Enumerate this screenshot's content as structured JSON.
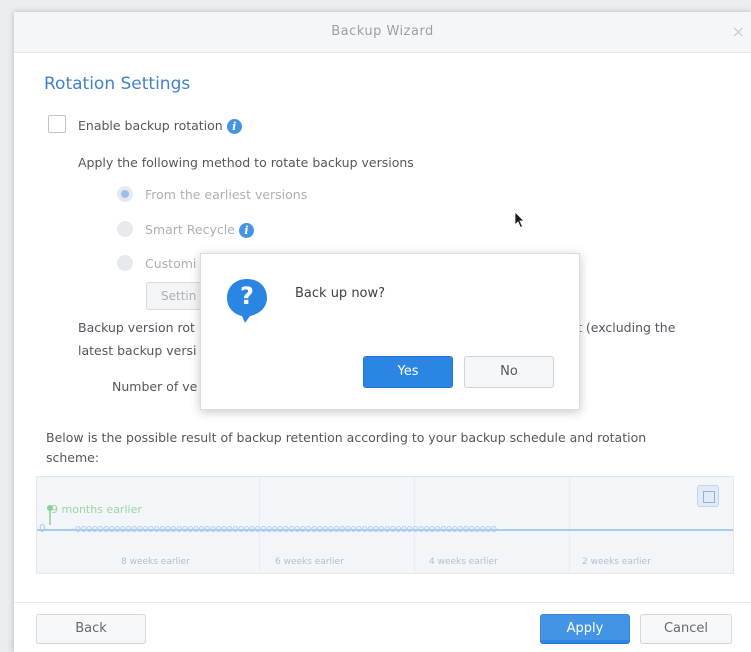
{
  "window": {
    "title": "Backup Wizard",
    "close_glyph": "×"
  },
  "section": {
    "title": "Rotation Settings"
  },
  "rotation": {
    "enable_label": "Enable backup rotation",
    "method_label": "Apply the following method to rotate backup versions",
    "options": [
      {
        "label": "From the earliest versions",
        "selected": true
      },
      {
        "label": "Smart Recycle",
        "selected": false
      },
      {
        "label": "Customi",
        "selected": false
      }
    ],
    "settings_button": "Settin",
    "rotation_text_1": "Backup version rot",
    "rotation_text_1_tail": "t (excluding the",
    "rotation_text_2": "latest backup versi",
    "versions_label": "Number of ve"
  },
  "retention": {
    "description_1": "Below is the possible result of backup retention according to your backup schedule and rotation",
    "description_2": "scheme:",
    "earliest_label": "9 months earlier",
    "week_labels": [
      "8 weeks earlier",
      "6 weeks earlier",
      "4 weeks earlier",
      "2 weeks earlier"
    ],
    "marker_glyphs": "-ooooooooooooooooooooooooooooooooooooooooooooooooooooooooooooooooooooooooooo",
    "start_glyph": "O–"
  },
  "footer": {
    "back": "Back",
    "apply": "Apply",
    "cancel": "Cancel"
  },
  "dialog": {
    "icon_glyph": "?",
    "message": "Back up now?",
    "yes": "Yes",
    "no": "No"
  },
  "colors": {
    "accent": "#2b86e3",
    "title_blue": "#2a70c4",
    "timeline_green": "#7cc98b"
  }
}
